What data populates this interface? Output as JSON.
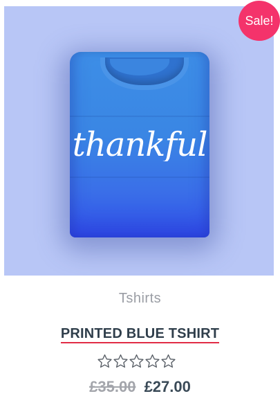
{
  "product": {
    "badge": "Sale!",
    "print_text": "thankful",
    "category": "Tshirts",
    "title": "PRINTED BLUE TSHIRT",
    "rating": {
      "value": 0,
      "max": 5
    },
    "price": {
      "old": "£35.00",
      "new": "£27.00"
    }
  },
  "colors": {
    "image_background": "#b8c6f6",
    "shirt": "#3a86e4",
    "sale_badge": "#f4336b",
    "title_underline": "#e12b45",
    "title_text": "#2f3e4b",
    "category_text": "#9a9da4",
    "old_price": "#a3a5ab",
    "new_price": "#3a4a57"
  },
  "icons": {
    "rating_star": "star-outline-icon"
  }
}
